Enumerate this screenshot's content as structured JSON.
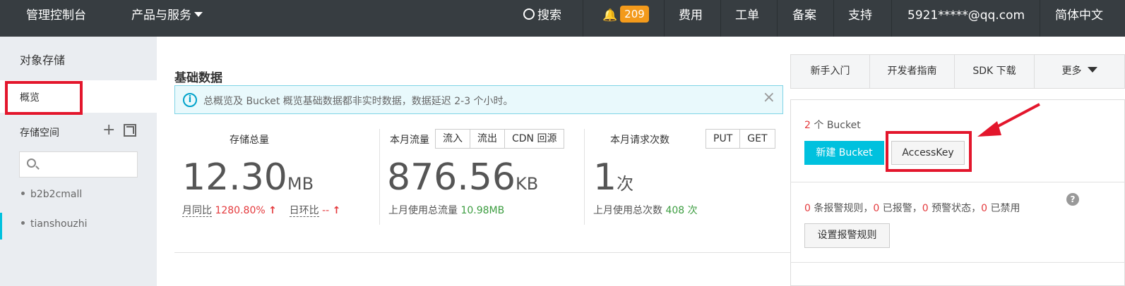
{
  "topbar": {
    "console": "管理控制台",
    "products": "产品与服务",
    "search": "搜索",
    "notifications": "209",
    "fees": "费用",
    "tickets": "工单",
    "filing": "备案",
    "support": "支持",
    "account": "5921*****@qq.com",
    "language": "简体中文"
  },
  "sidebar": {
    "title": "对象存储",
    "overview": "概览",
    "space": "存储空间",
    "buckets": [
      "b2b2cmall",
      "tianshouzhi"
    ]
  },
  "main": {
    "section_title": "基础数据",
    "notice": "总概览及 Bucket 概览基础数据都非实时数据，数据延迟 2-3 个小时。",
    "storage": {
      "label": "存储总量",
      "value": "12.30",
      "unit": "MB",
      "yoy_label": "月同比",
      "yoy_value": "1280.80%",
      "dod_label": "日环比",
      "dod_value": "--"
    },
    "traffic": {
      "label": "本月流量",
      "buttons": [
        "流入",
        "流出",
        "CDN 回源"
      ],
      "value": "876.56",
      "unit": "KB",
      "last_month_label": "上月使用总流量",
      "last_month_value": "10.98MB"
    },
    "requests": {
      "label": "本月请求次数",
      "buttons": [
        "PUT",
        "GET"
      ],
      "value": "1",
      "unit": "次",
      "last_month_label": "上月使用总次数",
      "last_month_value": "408 次"
    }
  },
  "right": {
    "tabs": [
      "新手入门",
      "开发者指南",
      "SDK 下载",
      "更多"
    ],
    "bucket_count": "2",
    "bucket_count_suffix": "个 Bucket",
    "new_bucket": "新建 Bucket",
    "access_key": "AccessKey",
    "alarm": {
      "rules_count": "0",
      "rules_label": "条报警规则，",
      "alarmed_count": "0",
      "alarmed_label": "已报警，",
      "warn_count": "0",
      "warn_label": "预警状态，",
      "disabled_count": "0",
      "disabled_label": "已禁用"
    },
    "set_alarm": "设置报警规则"
  },
  "colors": {
    "topbar_bg": "#373d41",
    "accent": "#00c1de",
    "badge": "#f39a1b",
    "highlight_red": "#e3162c"
  }
}
